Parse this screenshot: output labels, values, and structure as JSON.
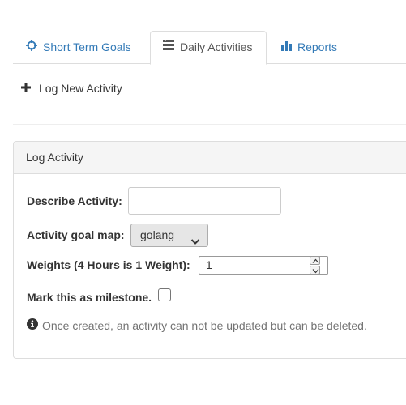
{
  "tabs": [
    {
      "label": "Short Term Goals",
      "icon": "crosshairs-icon",
      "active": false
    },
    {
      "label": "Daily Activities",
      "icon": "list-icon",
      "active": true
    },
    {
      "label": "Reports",
      "icon": "bar-chart-icon",
      "active": false
    }
  ],
  "actions": {
    "log_new_label": "Log New Activity"
  },
  "panel": {
    "title": "Log Activity",
    "describe_label": "Describe Activity:",
    "describe_value": "",
    "goal_map_label": "Activity goal map:",
    "goal_map_selected": "golang",
    "weights_label": "Weights (4 Hours is 1 Weight):",
    "weights_value": "1",
    "milestone_label": "Mark this as milestone.",
    "milestone_checked": false,
    "help_text": "Once created, an activity can not be updated but can be deleted."
  },
  "colors": {
    "link": "#337ab7",
    "text": "#333333",
    "muted": "#737373",
    "border": "#dddddd",
    "panel_heading_bg": "#f5f5f5",
    "select_bg": "#e6e6e6"
  }
}
